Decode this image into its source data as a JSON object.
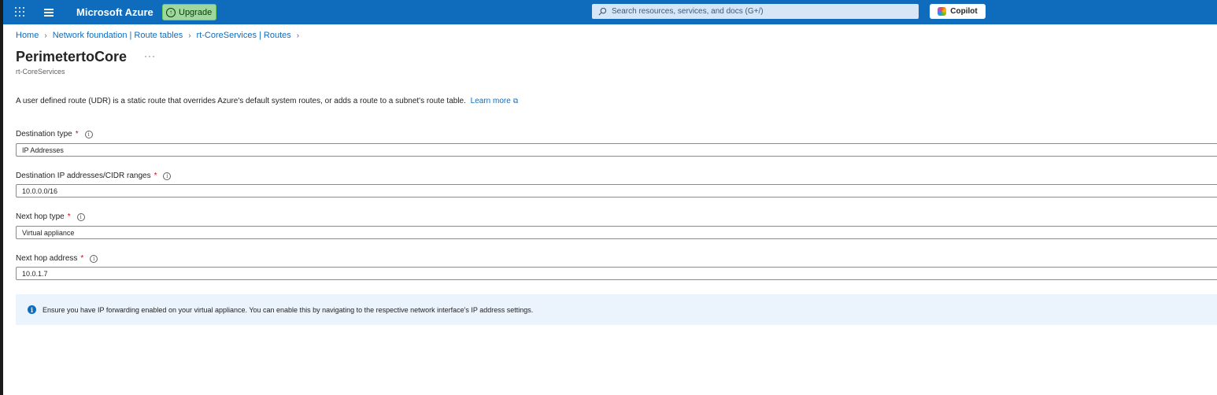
{
  "topbar": {
    "brand": "Microsoft Azure",
    "upgrade_label": "Upgrade",
    "search_placeholder": "Search resources, services, and docs (G+/)",
    "copilot_label": "Copilot",
    "accent_color": "#0f6cbd"
  },
  "breadcrumb": [
    "Home",
    "Network foundation | Route tables",
    "rt-CoreServices | Routes"
  ],
  "page": {
    "title": "PerimetertoCore",
    "more_label": "···",
    "subtitle": "rt-CoreServices",
    "description": "A user defined route (UDR) is a static route that overrides Azure's default system routes, or adds a route to a subnet's route table.",
    "learn_more": "Learn more"
  },
  "form": {
    "destination_type": {
      "label": "Destination type",
      "required": "*",
      "value": "IP Addresses"
    },
    "destination_ip": {
      "label": "Destination IP addresses/CIDR ranges",
      "required": "*",
      "value": "10.0.0.0/16"
    },
    "next_hop_type": {
      "label": "Next hop type",
      "required": "*",
      "value": "Virtual appliance"
    },
    "next_hop_address": {
      "label": "Next hop address",
      "required": "*",
      "value": "10.0.1.7"
    }
  },
  "banner": {
    "text": "Ensure you have IP forwarding enabled on your virtual appliance. You can enable this by navigating to the respective network interface's IP address settings."
  },
  "icons": [
    "waffle-icon",
    "hamburger-icon",
    "upgrade-icon",
    "search-icon",
    "copilot-icon",
    "chevron-right-icon",
    "external-link-icon",
    "info-icon"
  ]
}
